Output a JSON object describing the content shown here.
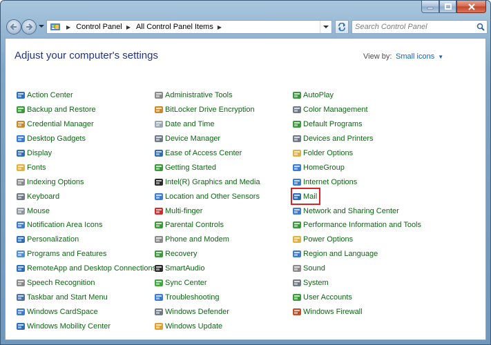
{
  "window": {
    "caption_min": "─",
    "caption_max": "□",
    "caption_close": "✕"
  },
  "nav": {
    "breadcrumbs": [
      "Control Panel",
      "All Control Panel Items"
    ],
    "search_placeholder": "Search Control Panel"
  },
  "main": {
    "title": "Adjust your computer's settings",
    "view_by_label": "View by:",
    "view_by_value": "Small icons"
  },
  "items": {
    "col1": [
      {
        "label": "Action Center",
        "icon": "flag-icon",
        "color": "#2b6fc7"
      },
      {
        "label": "Backup and Restore",
        "icon": "backup-icon",
        "color": "#3a9a3a"
      },
      {
        "label": "Credential Manager",
        "icon": "credential-icon",
        "color": "#c98a2a"
      },
      {
        "label": "Desktop Gadgets",
        "icon": "gadgets-icon",
        "color": "#3b7bd1"
      },
      {
        "label": "Display",
        "icon": "monitor-icon",
        "color": "#2f6db5"
      },
      {
        "label": "Fonts",
        "icon": "folder-fonts-icon",
        "color": "#e0b040"
      },
      {
        "label": "Indexing Options",
        "icon": "magnifier-icon",
        "color": "#8a8a8a"
      },
      {
        "label": "Keyboard",
        "icon": "keyboard-icon",
        "color": "#6f7a86"
      },
      {
        "label": "Mouse",
        "icon": "mouse-icon",
        "color": "#8f96a0"
      },
      {
        "label": "Notification Area Icons",
        "icon": "notification-icon",
        "color": "#3b7bd1"
      },
      {
        "label": "Personalization",
        "icon": "personalization-icon",
        "color": "#2f6db5"
      },
      {
        "label": "Programs and Features",
        "icon": "programs-icon",
        "color": "#4b8fd6"
      },
      {
        "label": "RemoteApp and Desktop Connections",
        "icon": "remoteapp-icon",
        "color": "#2f6db5"
      },
      {
        "label": "Speech Recognition",
        "icon": "microphone-icon",
        "color": "#8a8a8a"
      },
      {
        "label": "Taskbar and Start Menu",
        "icon": "taskbar-icon",
        "color": "#4a6fa0"
      },
      {
        "label": "Windows CardSpace",
        "icon": "cardspace-icon",
        "color": "#3b7bd1"
      },
      {
        "label": "Windows Mobility Center",
        "icon": "mobility-icon",
        "color": "#2f6db5"
      }
    ],
    "col2": [
      {
        "label": "Administrative Tools",
        "icon": "admin-tools-icon",
        "color": "#8a8a8a"
      },
      {
        "label": "BitLocker Drive Encryption",
        "icon": "bitlocker-icon",
        "color": "#c98a2a"
      },
      {
        "label": "Date and Time",
        "icon": "clock-icon",
        "color": "#9aa6b3"
      },
      {
        "label": "Device Manager",
        "icon": "device-manager-icon",
        "color": "#6f7a86"
      },
      {
        "label": "Ease of Access Center",
        "icon": "ease-of-access-icon",
        "color": "#2f6db5"
      },
      {
        "label": "Getting Started",
        "icon": "getting-started-icon",
        "color": "#3a9a3a"
      },
      {
        "label": "Intel(R) Graphics and Media",
        "icon": "intel-graphics-icon",
        "color": "#2a2a2a"
      },
      {
        "label": "Location and Other Sensors",
        "icon": "location-icon",
        "color": "#3b7bd1"
      },
      {
        "label": "Multi-finger",
        "icon": "multi-finger-icon",
        "color": "#d42b2b"
      },
      {
        "label": "Parental Controls",
        "icon": "parental-controls-icon",
        "color": "#3a9a3a"
      },
      {
        "label": "Phone and Modem",
        "icon": "phone-icon",
        "color": "#8a8a8a"
      },
      {
        "label": "Recovery",
        "icon": "recovery-icon",
        "color": "#3a9a3a"
      },
      {
        "label": "SmartAudio",
        "icon": "smartaudio-icon",
        "color": "#2a2a2a"
      },
      {
        "label": "Sync Center",
        "icon": "sync-icon",
        "color": "#3aaa3a"
      },
      {
        "label": "Troubleshooting",
        "icon": "troubleshooting-icon",
        "color": "#3b7bd1"
      },
      {
        "label": "Windows Defender",
        "icon": "defender-icon",
        "color": "#6f7a86"
      },
      {
        "label": "Windows Update",
        "icon": "windows-update-icon",
        "color": "#e0a030"
      }
    ],
    "col3": [
      {
        "label": "AutoPlay",
        "icon": "autoplay-icon",
        "color": "#3a9a3a"
      },
      {
        "label": "Color Management",
        "icon": "color-management-icon",
        "color": "#6f7a86"
      },
      {
        "label": "Default Programs",
        "icon": "default-programs-icon",
        "color": "#3a9a3a"
      },
      {
        "label": "Devices and Printers",
        "icon": "printer-icon",
        "color": "#6f7a86"
      },
      {
        "label": "Folder Options",
        "icon": "folder-icon",
        "color": "#e0b040"
      },
      {
        "label": "HomeGroup",
        "icon": "homegroup-icon",
        "color": "#3b7bd1"
      },
      {
        "label": "Internet Options",
        "icon": "internet-options-icon",
        "color": "#3b7bd1"
      },
      {
        "label": "Mail",
        "icon": "mail-icon",
        "color": "#2f6db5",
        "highlight": true
      },
      {
        "label": "Network and Sharing Center",
        "icon": "network-icon",
        "color": "#3b7bd1"
      },
      {
        "label": "Performance Information and Tools",
        "icon": "performance-icon",
        "color": "#3a9a3a"
      },
      {
        "label": "Power Options",
        "icon": "power-icon",
        "color": "#e0b040"
      },
      {
        "label": "Region and Language",
        "icon": "region-icon",
        "color": "#3b7bd1"
      },
      {
        "label": "Sound",
        "icon": "speaker-icon",
        "color": "#8a8a8a"
      },
      {
        "label": "System",
        "icon": "system-icon",
        "color": "#6f7a86"
      },
      {
        "label": "User Accounts",
        "icon": "user-accounts-icon",
        "color": "#3a9a3a"
      },
      {
        "label": "Windows Firewall",
        "icon": "firewall-icon",
        "color": "#c0502a"
      }
    ]
  }
}
